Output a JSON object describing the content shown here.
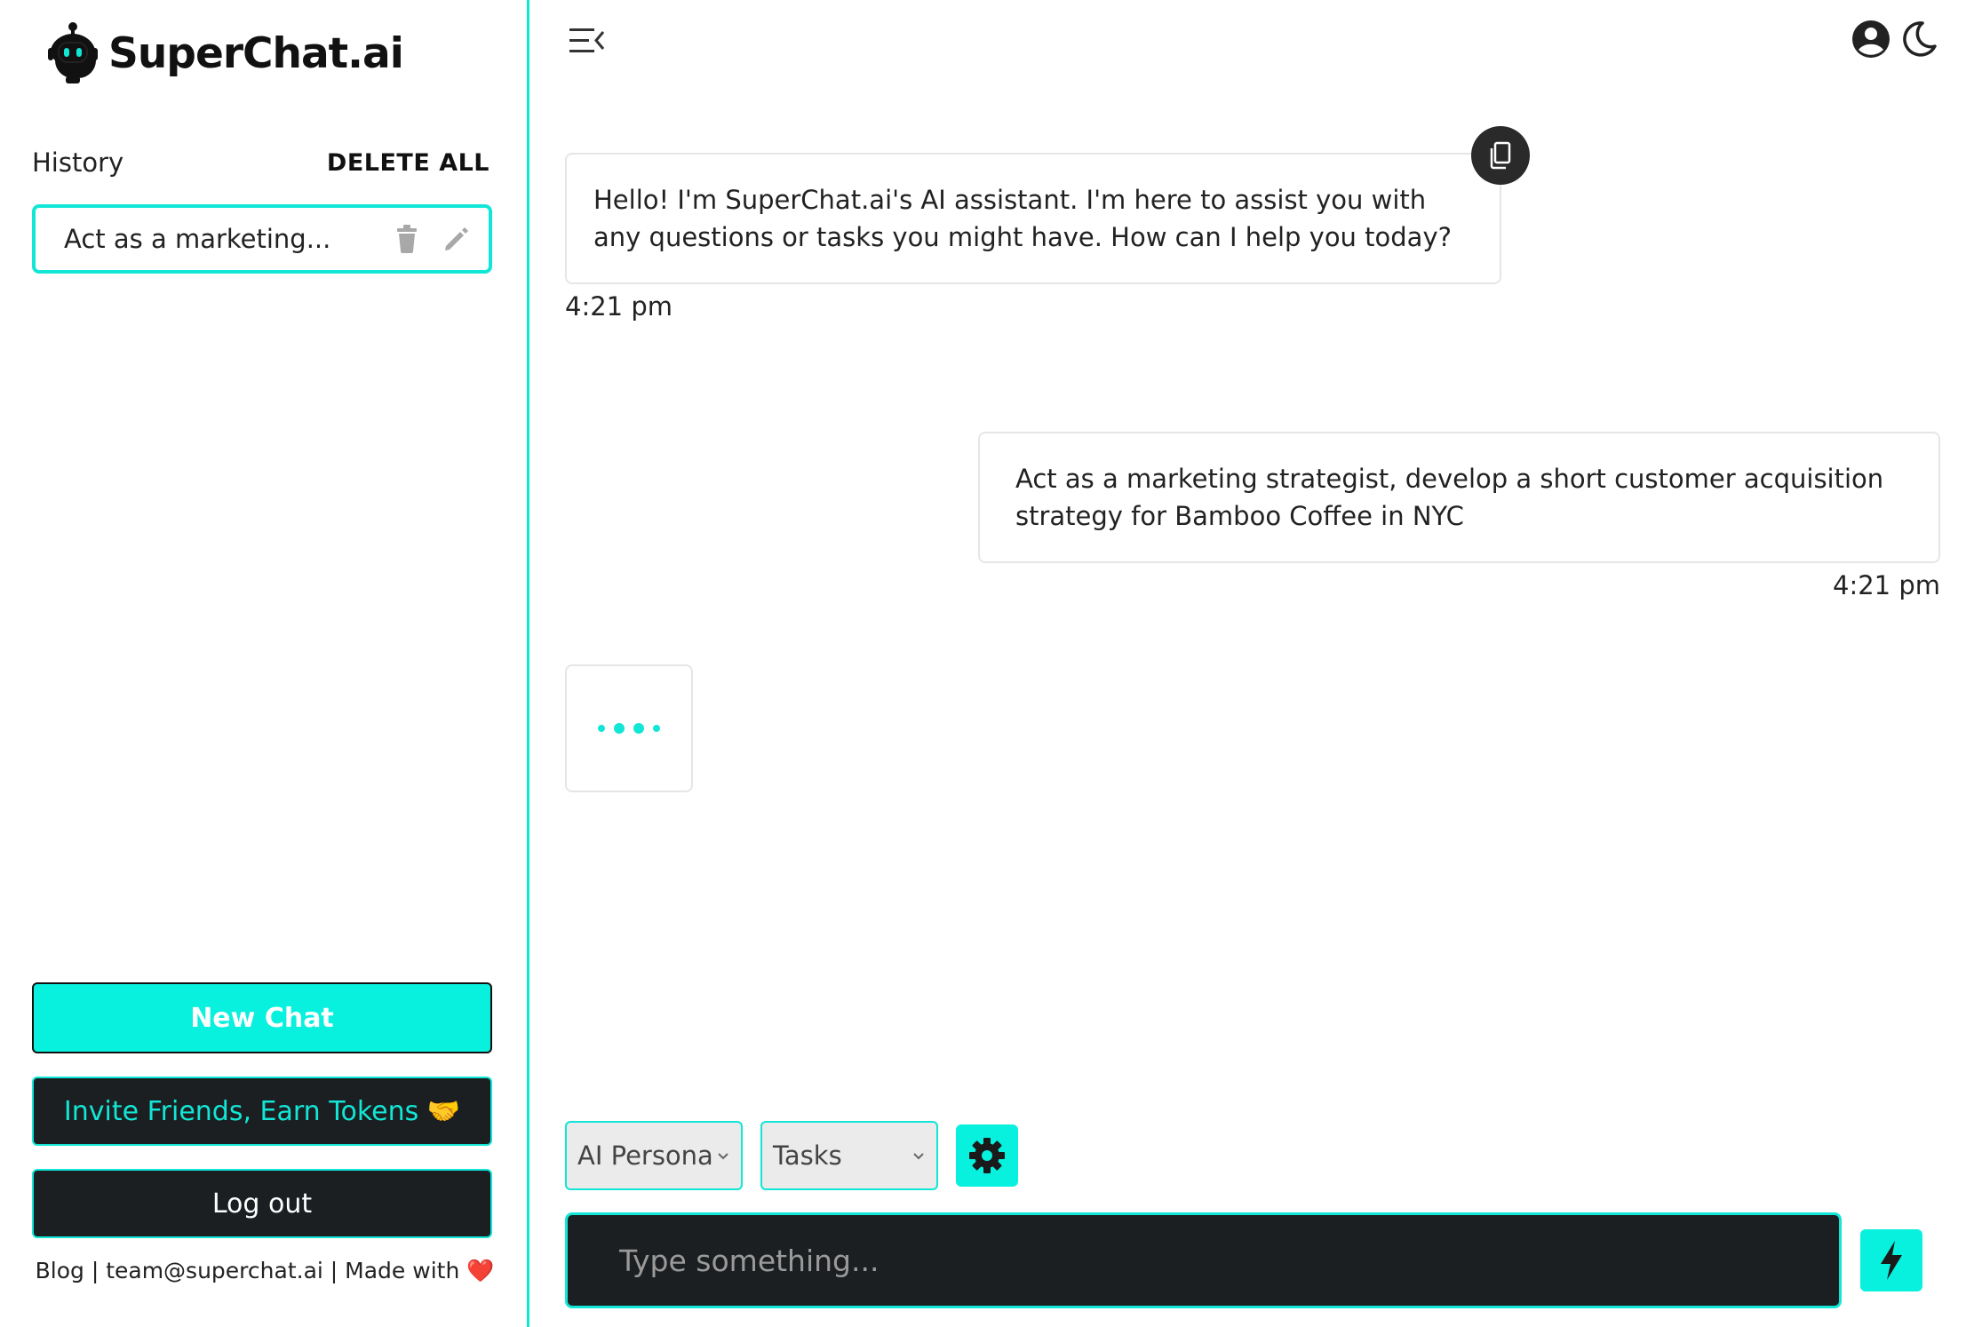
{
  "app": {
    "brand": "SuperChat.ai",
    "progress_fraction": 0.17,
    "accent_color": "#12e6d6",
    "dark_color": "#1c1f21"
  },
  "sidebar": {
    "history_label": "History",
    "delete_all_label": "DELETE ALL",
    "history_items": [
      {
        "title": "Act as a marketing..."
      }
    ],
    "new_chat_label": "New Chat",
    "invite_label": "Invite Friends, Earn Tokens 🤝",
    "logout_label": "Log out",
    "footer": {
      "blog": "Blog",
      "sep1": " | ",
      "email": "team@superchat.ai",
      "sep2": " | ",
      "made_with": "Made with ",
      "heart": "❤️"
    }
  },
  "header": {
    "icons": [
      "menu-collapse-icon",
      "user-circle-icon",
      "moon-icon"
    ]
  },
  "chat": {
    "messages": [
      {
        "role": "assistant",
        "text": "Hello! I'm SuperChat.ai's AI assistant. I'm here to assist you with any questions or tasks you might have. How can I help you today?",
        "time": "4:21 pm"
      },
      {
        "role": "user",
        "text": "Act as a marketing strategist, develop a short customer acquisition strategy for Bamboo Coffee in NYC",
        "time": "4:21 pm"
      }
    ],
    "typing_indicator": true
  },
  "composer": {
    "persona_select": "AI Persona",
    "tasks_select": "Tasks",
    "placeholder": "Type something...",
    "value": ""
  }
}
